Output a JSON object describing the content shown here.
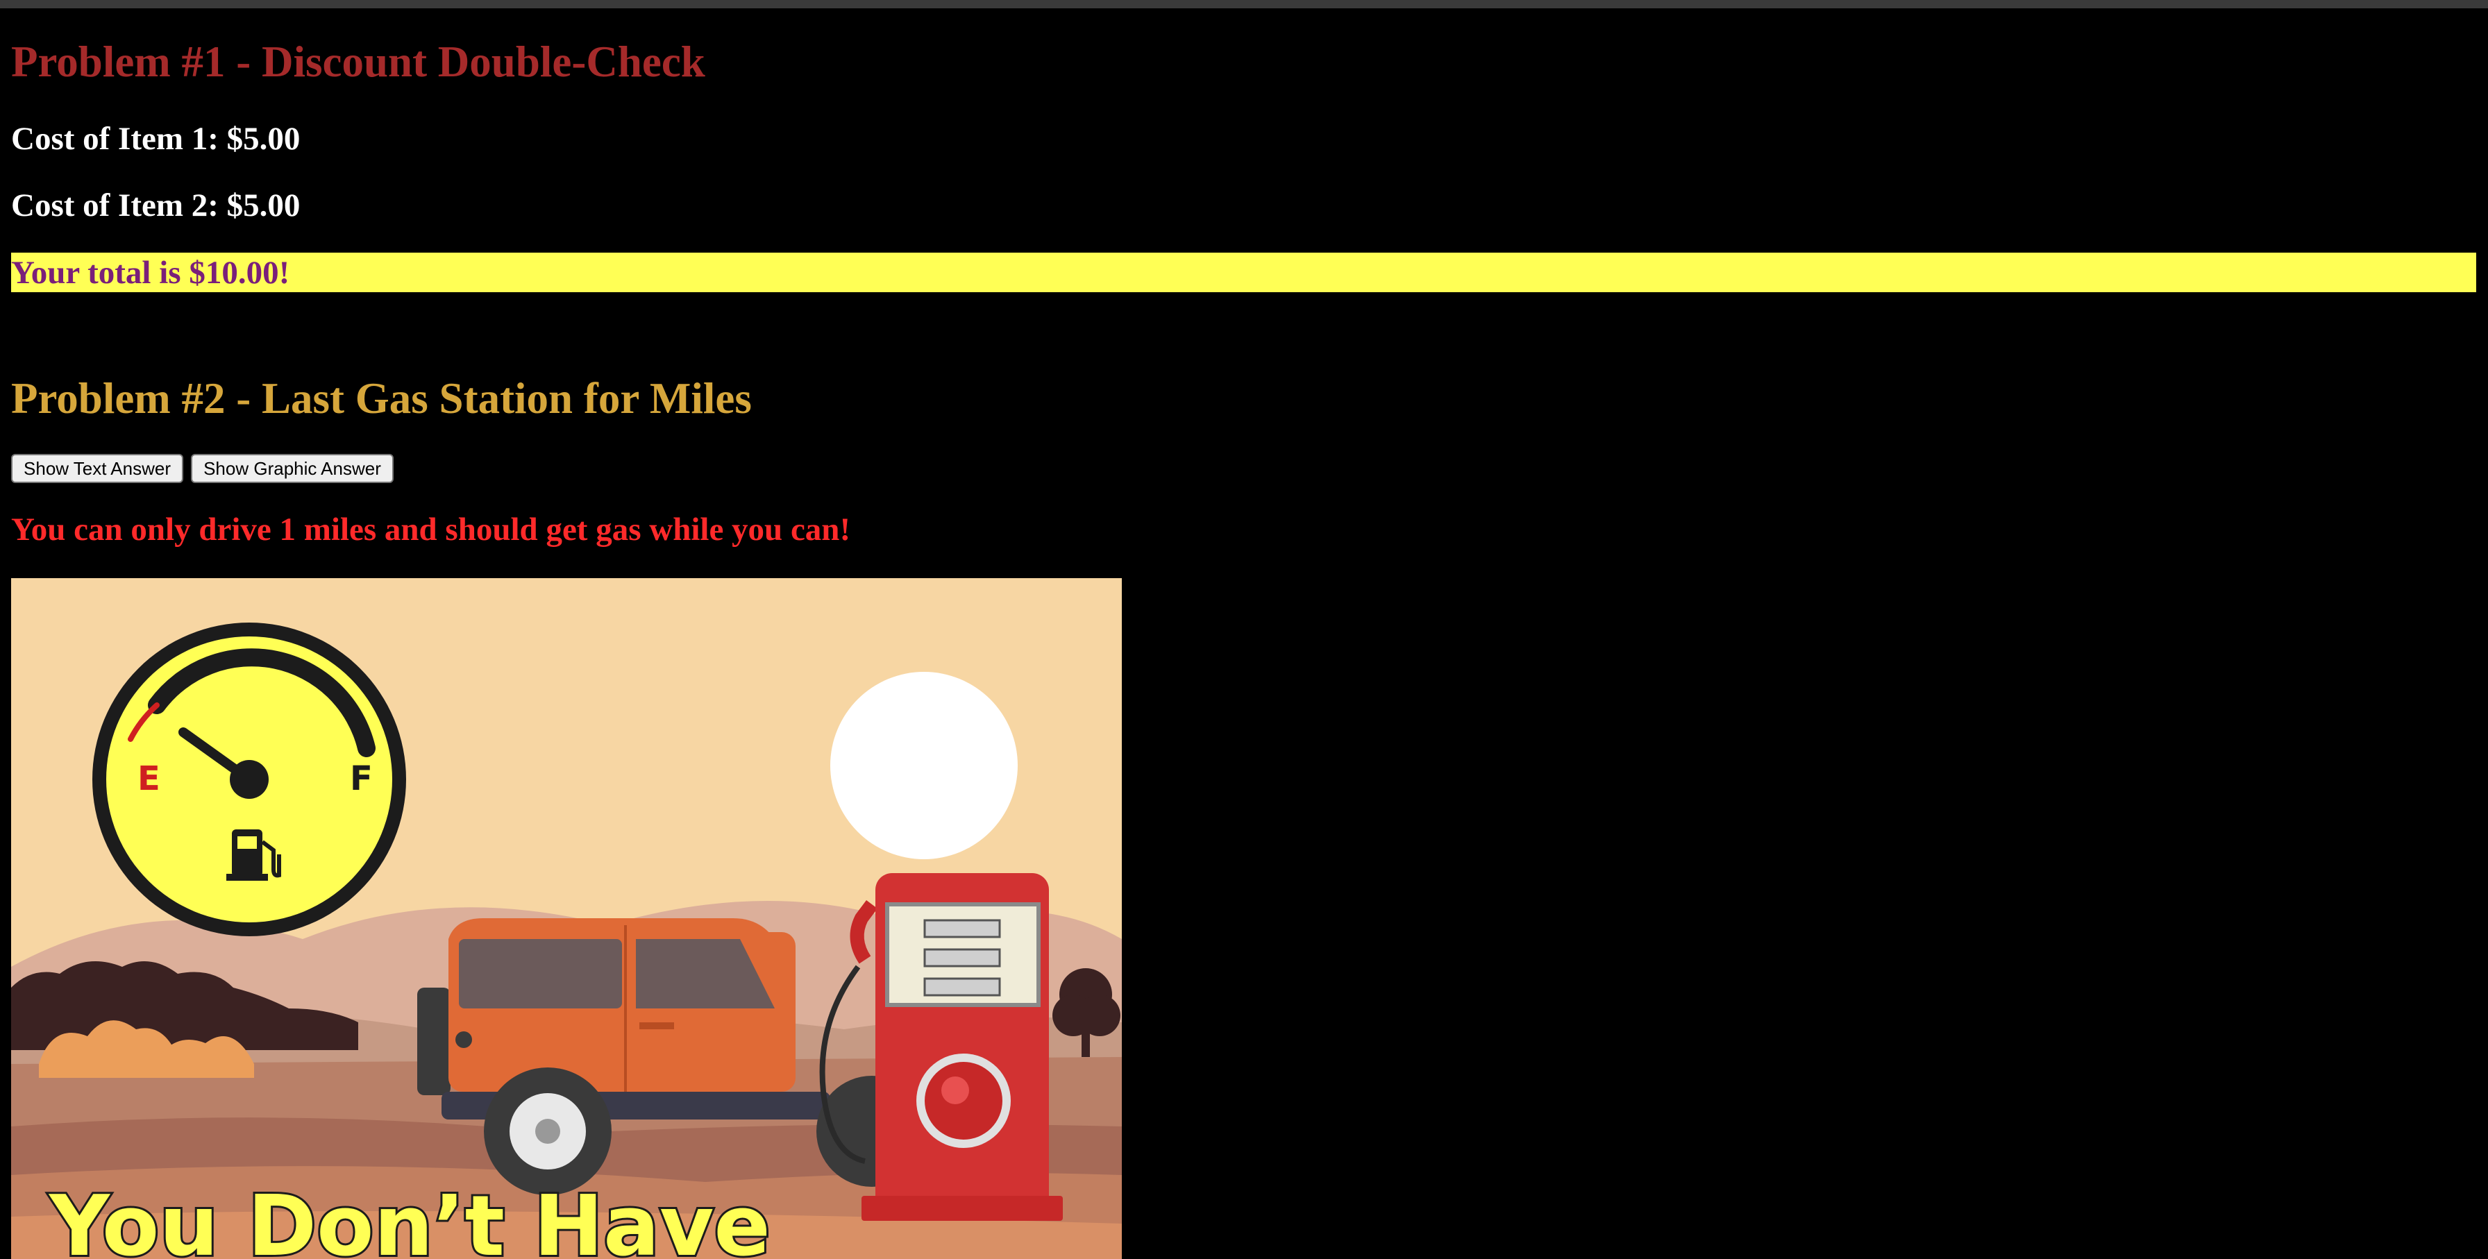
{
  "problem1": {
    "title": "Problem #1 - Discount Double-Check",
    "cost_item1": "Cost of Item 1: $5.00",
    "cost_item2": "Cost of Item 2: $5.00",
    "total": "Your total is $10.00!"
  },
  "problem2": {
    "title": "Problem #2 - Last Gas Station for Miles",
    "buttons": {
      "text_answer": "Show Text Answer",
      "graphic_answer": "Show Graphic Answer"
    },
    "message": "You can only drive 1 miles and should get gas while you can!",
    "illustration": {
      "gauge_empty_label": "E",
      "gauge_full_label": "F",
      "banner": "You Don’t Have",
      "fuel_level": 0.12,
      "icons": [
        "fuel-gauge-icon",
        "fuel-pump-icon",
        "sun-icon",
        "jeep-icon",
        "gas-pump-icon"
      ]
    }
  },
  "colors": {
    "background": "#000000",
    "problem1_title": "#a52a2a",
    "problem2_title": "#d6a63b",
    "total_highlight": "#ffff55",
    "total_text": "#7a1f7a",
    "warning_text": "#ff2a2a"
  }
}
